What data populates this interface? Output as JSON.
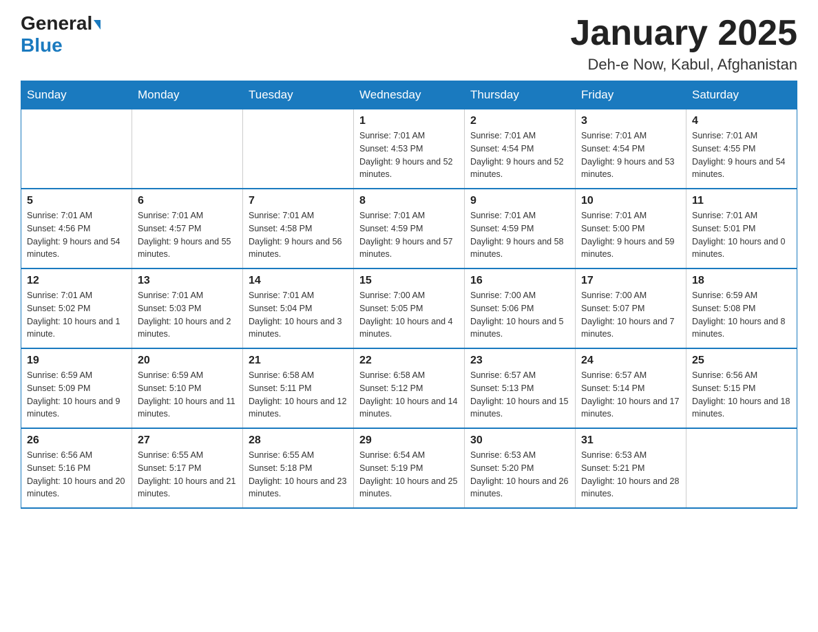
{
  "header": {
    "logo_general": "General",
    "logo_blue": "Blue",
    "title": "January 2025",
    "location": "Deh-e Now, Kabul, Afghanistan"
  },
  "weekdays": [
    "Sunday",
    "Monday",
    "Tuesday",
    "Wednesday",
    "Thursday",
    "Friday",
    "Saturday"
  ],
  "weeks": [
    [
      {
        "day": "",
        "info": ""
      },
      {
        "day": "",
        "info": ""
      },
      {
        "day": "",
        "info": ""
      },
      {
        "day": "1",
        "info": "Sunrise: 7:01 AM\nSunset: 4:53 PM\nDaylight: 9 hours and 52 minutes."
      },
      {
        "day": "2",
        "info": "Sunrise: 7:01 AM\nSunset: 4:54 PM\nDaylight: 9 hours and 52 minutes."
      },
      {
        "day": "3",
        "info": "Sunrise: 7:01 AM\nSunset: 4:54 PM\nDaylight: 9 hours and 53 minutes."
      },
      {
        "day": "4",
        "info": "Sunrise: 7:01 AM\nSunset: 4:55 PM\nDaylight: 9 hours and 54 minutes."
      }
    ],
    [
      {
        "day": "5",
        "info": "Sunrise: 7:01 AM\nSunset: 4:56 PM\nDaylight: 9 hours and 54 minutes."
      },
      {
        "day": "6",
        "info": "Sunrise: 7:01 AM\nSunset: 4:57 PM\nDaylight: 9 hours and 55 minutes."
      },
      {
        "day": "7",
        "info": "Sunrise: 7:01 AM\nSunset: 4:58 PM\nDaylight: 9 hours and 56 minutes."
      },
      {
        "day": "8",
        "info": "Sunrise: 7:01 AM\nSunset: 4:59 PM\nDaylight: 9 hours and 57 minutes."
      },
      {
        "day": "9",
        "info": "Sunrise: 7:01 AM\nSunset: 4:59 PM\nDaylight: 9 hours and 58 minutes."
      },
      {
        "day": "10",
        "info": "Sunrise: 7:01 AM\nSunset: 5:00 PM\nDaylight: 9 hours and 59 minutes."
      },
      {
        "day": "11",
        "info": "Sunrise: 7:01 AM\nSunset: 5:01 PM\nDaylight: 10 hours and 0 minutes."
      }
    ],
    [
      {
        "day": "12",
        "info": "Sunrise: 7:01 AM\nSunset: 5:02 PM\nDaylight: 10 hours and 1 minute."
      },
      {
        "day": "13",
        "info": "Sunrise: 7:01 AM\nSunset: 5:03 PM\nDaylight: 10 hours and 2 minutes."
      },
      {
        "day": "14",
        "info": "Sunrise: 7:01 AM\nSunset: 5:04 PM\nDaylight: 10 hours and 3 minutes."
      },
      {
        "day": "15",
        "info": "Sunrise: 7:00 AM\nSunset: 5:05 PM\nDaylight: 10 hours and 4 minutes."
      },
      {
        "day": "16",
        "info": "Sunrise: 7:00 AM\nSunset: 5:06 PM\nDaylight: 10 hours and 5 minutes."
      },
      {
        "day": "17",
        "info": "Sunrise: 7:00 AM\nSunset: 5:07 PM\nDaylight: 10 hours and 7 minutes."
      },
      {
        "day": "18",
        "info": "Sunrise: 6:59 AM\nSunset: 5:08 PM\nDaylight: 10 hours and 8 minutes."
      }
    ],
    [
      {
        "day": "19",
        "info": "Sunrise: 6:59 AM\nSunset: 5:09 PM\nDaylight: 10 hours and 9 minutes."
      },
      {
        "day": "20",
        "info": "Sunrise: 6:59 AM\nSunset: 5:10 PM\nDaylight: 10 hours and 11 minutes."
      },
      {
        "day": "21",
        "info": "Sunrise: 6:58 AM\nSunset: 5:11 PM\nDaylight: 10 hours and 12 minutes."
      },
      {
        "day": "22",
        "info": "Sunrise: 6:58 AM\nSunset: 5:12 PM\nDaylight: 10 hours and 14 minutes."
      },
      {
        "day": "23",
        "info": "Sunrise: 6:57 AM\nSunset: 5:13 PM\nDaylight: 10 hours and 15 minutes."
      },
      {
        "day": "24",
        "info": "Sunrise: 6:57 AM\nSunset: 5:14 PM\nDaylight: 10 hours and 17 minutes."
      },
      {
        "day": "25",
        "info": "Sunrise: 6:56 AM\nSunset: 5:15 PM\nDaylight: 10 hours and 18 minutes."
      }
    ],
    [
      {
        "day": "26",
        "info": "Sunrise: 6:56 AM\nSunset: 5:16 PM\nDaylight: 10 hours and 20 minutes."
      },
      {
        "day": "27",
        "info": "Sunrise: 6:55 AM\nSunset: 5:17 PM\nDaylight: 10 hours and 21 minutes."
      },
      {
        "day": "28",
        "info": "Sunrise: 6:55 AM\nSunset: 5:18 PM\nDaylight: 10 hours and 23 minutes."
      },
      {
        "day": "29",
        "info": "Sunrise: 6:54 AM\nSunset: 5:19 PM\nDaylight: 10 hours and 25 minutes."
      },
      {
        "day": "30",
        "info": "Sunrise: 6:53 AM\nSunset: 5:20 PM\nDaylight: 10 hours and 26 minutes."
      },
      {
        "day": "31",
        "info": "Sunrise: 6:53 AM\nSunset: 5:21 PM\nDaylight: 10 hours and 28 minutes."
      },
      {
        "day": "",
        "info": ""
      }
    ]
  ]
}
